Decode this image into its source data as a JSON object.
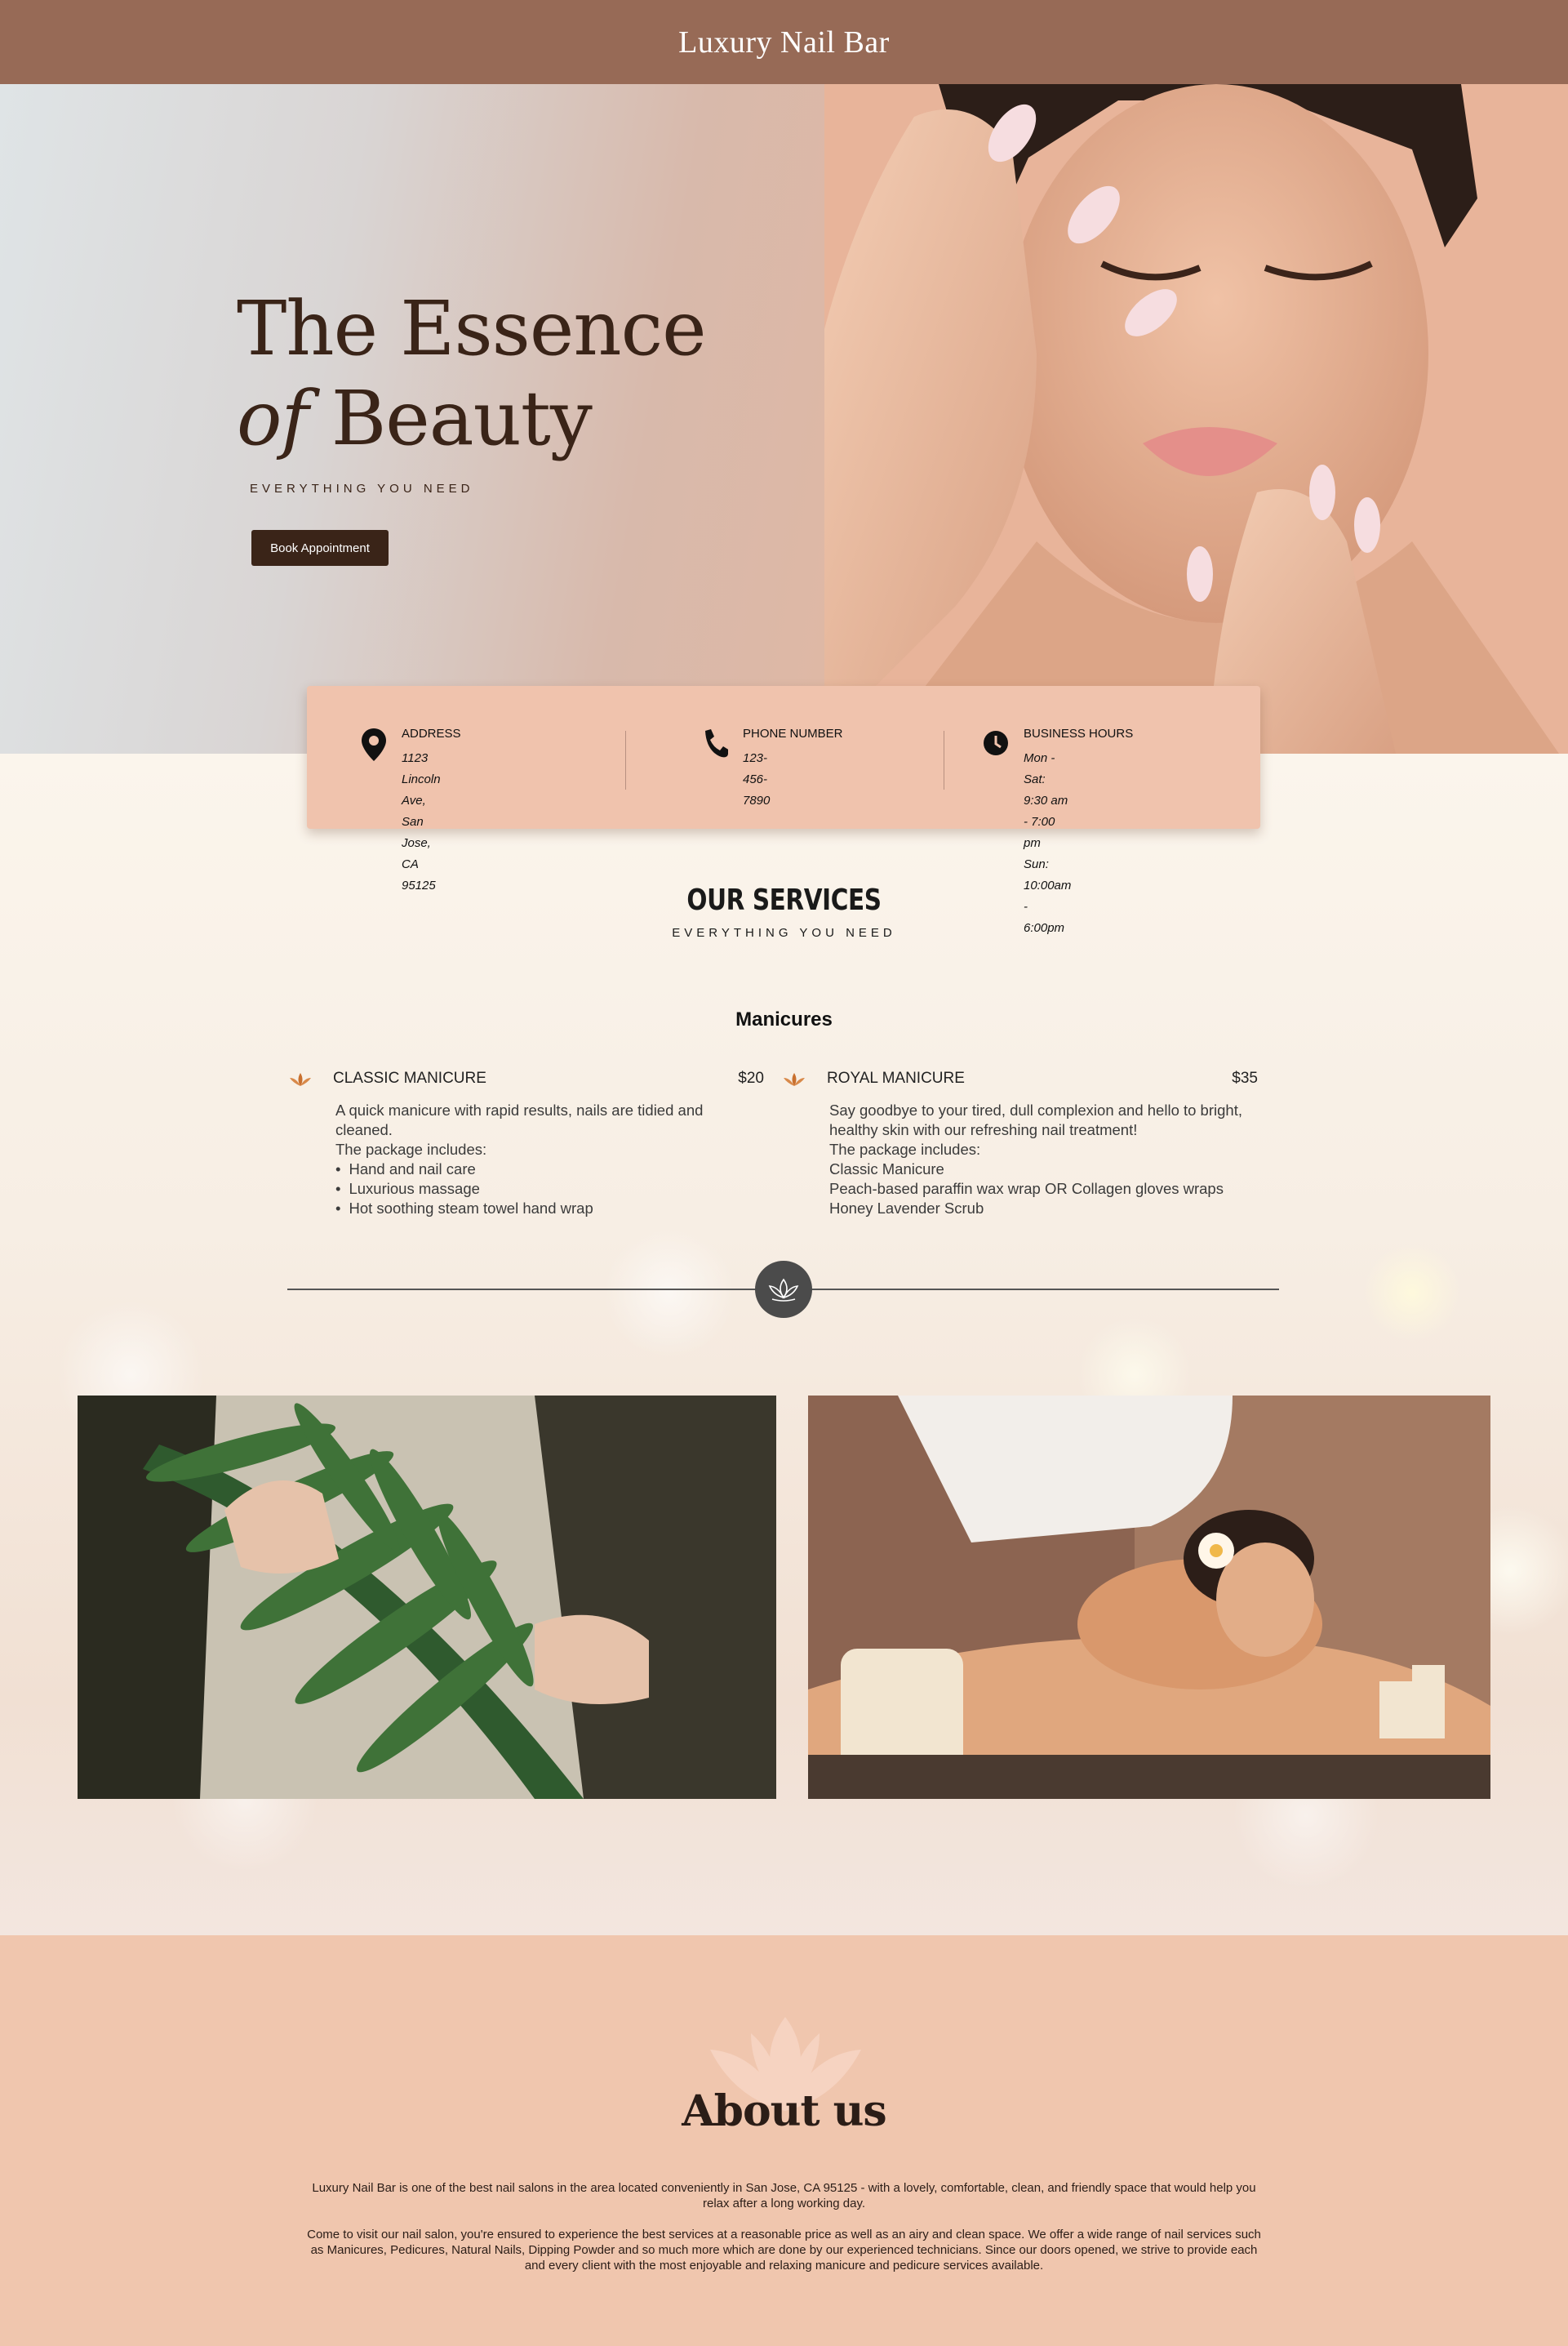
{
  "header": {
    "brand": "Luxury Nail Bar"
  },
  "hero": {
    "title_line1": "The Essence",
    "title_of": "of",
    "title_beauty": "Beauty",
    "tagline": "EVERYTHING YOU NEED",
    "cta_label": "Book Appointment"
  },
  "info": {
    "address": {
      "label": "ADDRESS",
      "line1": "1123 Lincoln Ave, San Jose,",
      "line2": "CA 95125",
      "icon": "map-pin-icon"
    },
    "phone": {
      "label": "PHONE NUMBER",
      "value": "123-456-7890",
      "icon": "phone-icon"
    },
    "hours": {
      "label": "BUSINESS HOURS",
      "line1": "Mon - Sat: 9:30 am - 7:00 pm",
      "line2": "Sun: 10:00am - 6:00pm",
      "icon": "clock-icon"
    }
  },
  "services": {
    "title": "OUR SERVICES",
    "subtitle": "EVERYTHING YOU NEED",
    "category": "Manicures",
    "items": [
      {
        "name": "CLASSIC MANICURE",
        "price": "$20",
        "intro": "A quick manicure with rapid results, nails are tidied and cleaned.",
        "includes_label": "The package includes:",
        "includes": [
          "Hand and nail care",
          "Luxurious massage",
          "Hot soothing steam towel hand wrap"
        ]
      },
      {
        "name": "ROYAL MANICURE",
        "price": "$35",
        "intro": "Say goodbye to your tired, dull complexion and hello to bright, healthy skin with our refreshing nail treatment!",
        "includes_label": "The package includes:",
        "includes": [
          "Classic Manicure",
          "Peach-based paraffin wax wrap OR Collagen gloves wraps",
          "Honey Lavender Scrub"
        ]
      }
    ]
  },
  "about": {
    "title": "About us",
    "paragraph1": "Luxury Nail Bar is one of the best nail salons in the area located conveniently in San Jose, CA 95125 - with a lovely, comfortable, clean, and friendly space that would help you relax after a long working day.",
    "paragraph2": "Come to visit our nail salon, you're ensured to experience the best services at a reasonable price as well as an airy and clean space. We offer a wide range of nail services such as Manicures, Pedicures, Natural Nails, Dipping Powder and so much more which are done by our experienced technicians. Since our doors opened, we strive to provide each and every client with the most enjoyable and relaxing manicure and pedicure services available."
  },
  "colors": {
    "header_bg": "#976a56",
    "accent_dark": "#3a2418",
    "card_bg": "#f0c3ad",
    "about_bg": "#f0c6ae"
  }
}
